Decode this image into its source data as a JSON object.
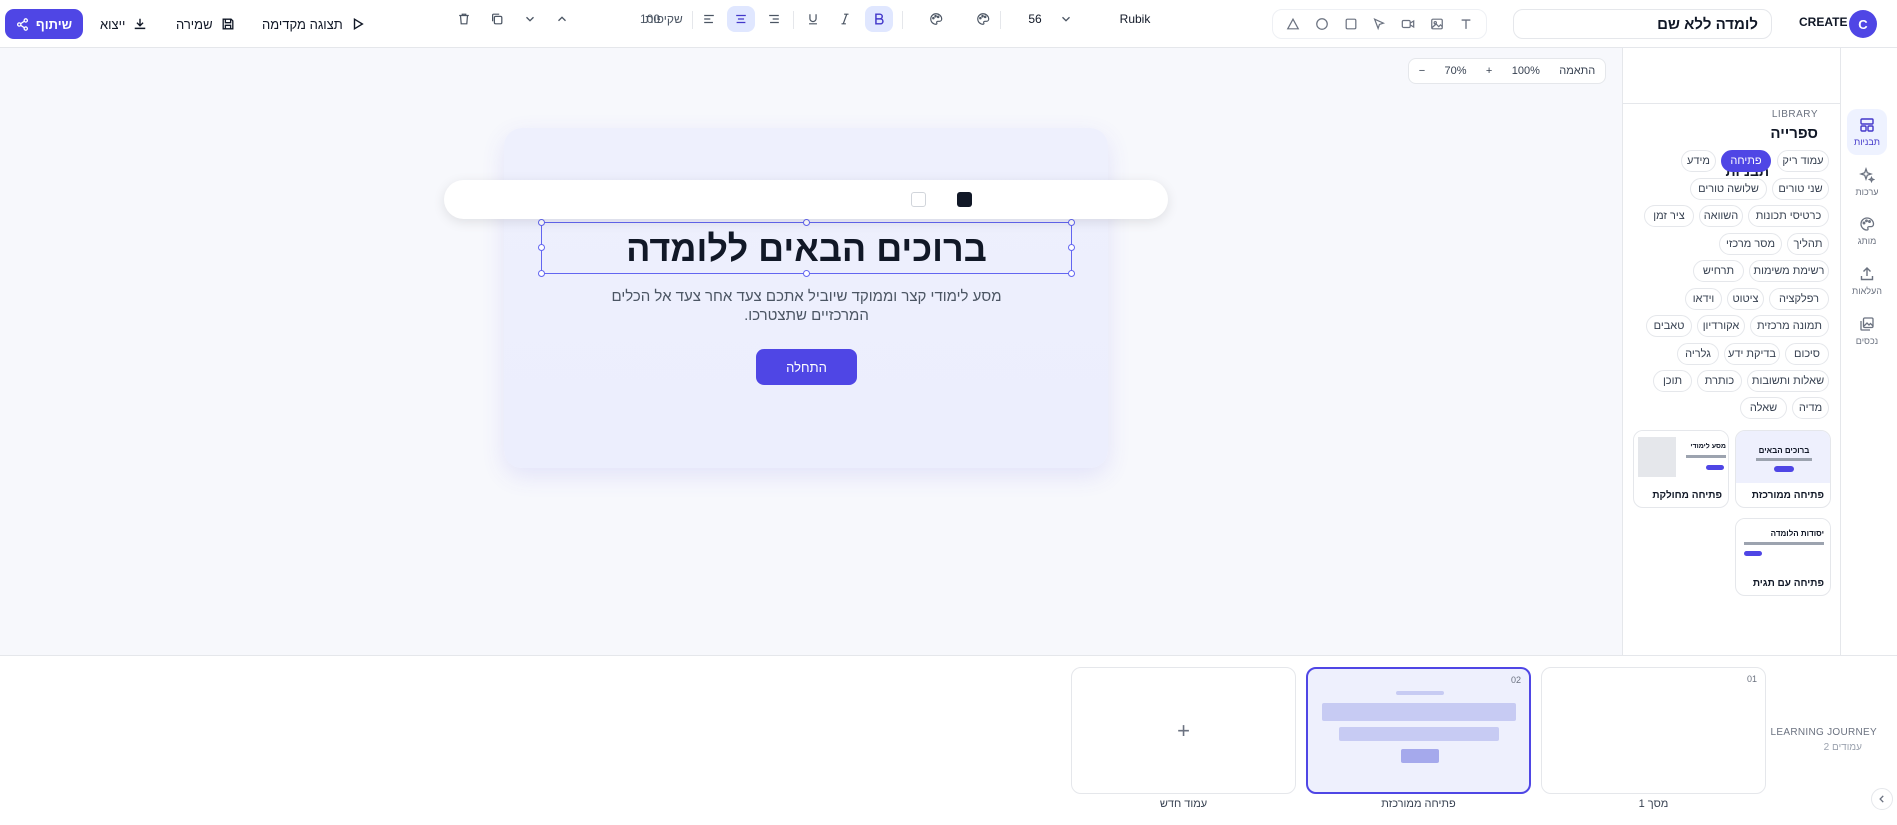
{
  "topbar": {
    "share_label": "שיתוף",
    "export_label": "ייצוא",
    "save_label": "שמירה",
    "preview_label": "תצוגה מקדימה",
    "title_value": "לומדה ללא שם",
    "brand": "CREATE",
    "avatar_letter": "C"
  },
  "zoom": {
    "minus": "−",
    "level": "70%",
    "plus": "+",
    "reset": "100%",
    "fit": "התאמה"
  },
  "format_toolbar": {
    "font_family": "Rubik",
    "font_size": "56",
    "opacity_label": "שקיפות",
    "opacity_value": "100"
  },
  "slide_content": {
    "heading": "ברוכים הבאים ללומדה",
    "subtitle": "מסע לימודי קצר וממוקד שיוביל אתכם צעד אחר צעד אל הכלים המרכזיים שתצטרכו.",
    "button": "התחלה"
  },
  "library": {
    "sub": "LIBRARY",
    "title": "ספרייה",
    "section_title": "תבניות",
    "chips": [
      "עמוד ריק",
      "פתיחה",
      "מידע",
      "שני טורים",
      "שלושה טורים",
      "כרטיסי תכונות",
      "השוואה",
      "ציר זמן",
      "תהליך",
      "מסר מרכזי",
      "רשימת משימות",
      "תרחיש",
      "רפלקציה",
      "ציטוט",
      "וידאו",
      "תמונה מרכזית",
      "אקורדיון",
      "טאבים",
      "סיכום",
      "בדיקת ידע",
      "גלריה",
      "שאלות ותשובות",
      "כותרת",
      "תוכן",
      "מדיה",
      "שאלה"
    ],
    "templates": [
      "פתיחה ממורכזת",
      "פתיחה מחולקת",
      "פתיחה עם תגית"
    ],
    "template_thumb_texts": [
      "ברוכים הבאים",
      "מסע לימודי",
      "יסודות הלומדה"
    ]
  },
  "rail": [
    "תבניות",
    "ערכות",
    "מותג",
    "העלאות",
    "נכסים"
  ],
  "journey": {
    "title": "LEARNING JOURNEY",
    "count": "2 עמודים",
    "slides": [
      {
        "num": "01",
        "label": "מסך 1"
      },
      {
        "num": "02",
        "label": "פתיחה ממורכזת"
      }
    ],
    "new_label": "עמוד חדש",
    "plus": "+"
  },
  "colors": {
    "accent": "#4f46e5",
    "text_color_swatch": "#111827"
  }
}
